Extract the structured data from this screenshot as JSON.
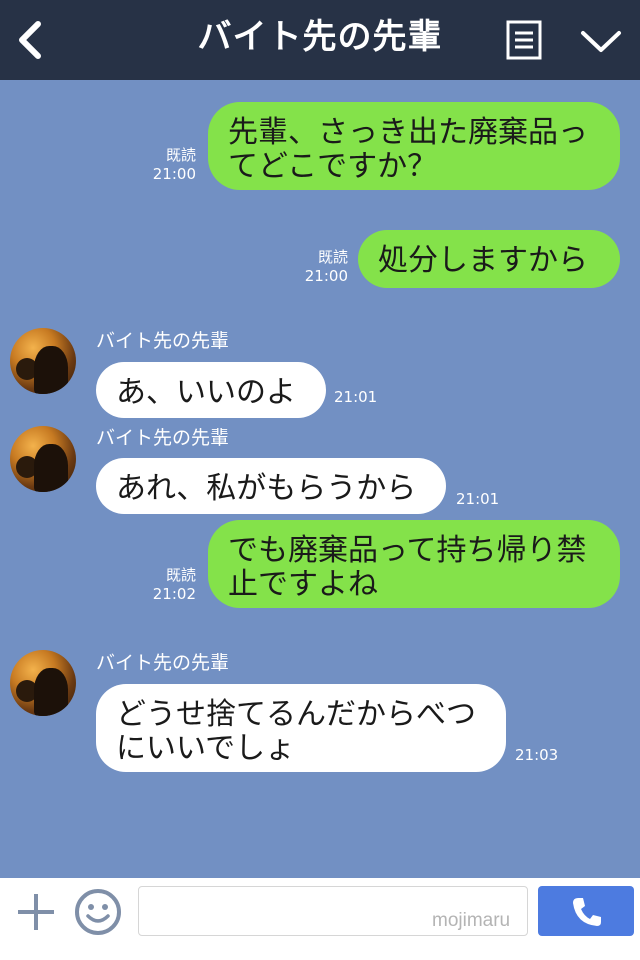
{
  "header": {
    "title": "バイト先の先輩",
    "back_icon": "chevron-left-icon",
    "menu_icon": "notes-icon",
    "dropdown_icon": "chevron-down-icon"
  },
  "messages": [
    {
      "direction": "out",
      "text": "先輩、さっき出た廃棄品ってどこですか？",
      "read": "既読",
      "time": "21:00"
    },
    {
      "direction": "out",
      "text": "処分しますから",
      "read": "既読",
      "time": "21:00"
    },
    {
      "direction": "in",
      "sender": "バイト先の先輩",
      "text": "あ、いいのよ",
      "time": "21:01"
    },
    {
      "direction": "in",
      "sender": "バイト先の先輩",
      "text": "あれ、私がもらうから",
      "time": "21:01"
    },
    {
      "direction": "out",
      "text": "でも廃棄品って持ち帰り禁止ですよね",
      "read": "既読",
      "time": "21:02"
    },
    {
      "direction": "in",
      "sender": "バイト先の先輩",
      "text": "どうせ捨てるんだからべつにいいでしょ",
      "time": "21:03"
    }
  ],
  "input_bar": {
    "plus_icon": "plus-icon",
    "emoji_icon": "smiley-icon",
    "placeholder": "",
    "watermark": "mojimaru",
    "call_icon": "phone-icon"
  },
  "colors": {
    "header_bg": "#273246",
    "chat_bg": "#7290c3",
    "outgoing_bubble": "#84e24a",
    "incoming_bubble": "#ffffff",
    "call_button": "#4d7be0"
  }
}
